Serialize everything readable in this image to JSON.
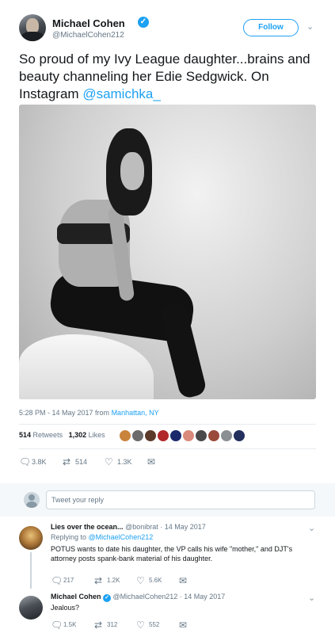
{
  "tweet": {
    "author_name": "Michael Cohen",
    "author_handle": "@MichaelCohen212",
    "verified_icon": "verified-badge-icon",
    "follow_label": "Follow",
    "text_main": "So proud of my Ivy League daughter...brains and beauty channeling her Edie Sedgwick. On Instagram ",
    "text_mention": "@samichka_",
    "timestamp": "5:28 PM - 14 May 2017 from ",
    "location": "Manhattan, NY",
    "retweets_count": "514",
    "retweets_label": "Retweets",
    "likes_count": "1,302",
    "likes_label": "Likes",
    "likers_colors": [
      "#c9833d",
      "#6b6b6b",
      "#5b3a2a",
      "#b1282b",
      "#1b2a6b",
      "#d98a7a",
      "#4a4a4a",
      "#9a4a3a",
      "#8a8f94",
      "#23305e"
    ],
    "actions": {
      "replies": "3.8K",
      "retweets": "514",
      "likes": "1.3K"
    }
  },
  "reply_box": {
    "placeholder": "Tweet your reply"
  },
  "replies": [
    {
      "name": "Lies over the ocean...",
      "handle": "@bonibrat",
      "date": "· 14 May 2017",
      "replying_prefix": "Replying to ",
      "replying_to": "@MichaelCohen212",
      "text": "POTUS wants to date his daughter, the VP calls his wife \"mother,\" and DJT's attorney posts spank-bank material of his daughter.",
      "replies": "217",
      "retweets": "1.2K",
      "likes": "5.6K"
    },
    {
      "name": "Michael Cohen",
      "handle": "@MichaelCohen212",
      "date": "· 14 May 2017",
      "text": "Jealous?",
      "replies": "1.5K",
      "retweets": "312",
      "likes": "552"
    }
  ],
  "icons": {
    "reply": "reply-icon",
    "retweet": "retweet-icon",
    "like": "heart-icon",
    "dm": "envelope-icon",
    "caret": "chevron-down-icon"
  }
}
